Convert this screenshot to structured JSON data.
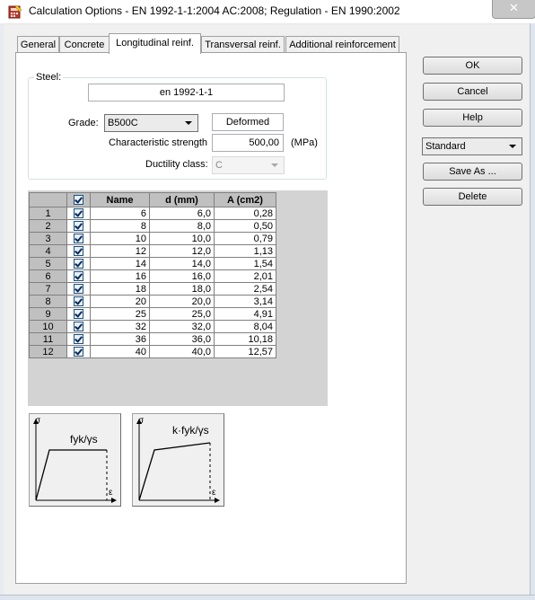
{
  "window": {
    "title": "Calculation Options - EN 1992-1-1:2004 AC:2008;   Regulation - EN 1990:2002",
    "close_glyph": "✕"
  },
  "tabs": [
    {
      "label": "General",
      "active": false
    },
    {
      "label": "Concrete",
      "active": false
    },
    {
      "label": "Longitudinal reinf.",
      "active": true
    },
    {
      "label": "Transversal reinf.",
      "active": false
    },
    {
      "label": "Additional reinforcement",
      "active": false
    }
  ],
  "steel": {
    "group_label": "Steel:",
    "standard_value": "en 1992-1-1",
    "grade_label": "Grade:",
    "grade_value": "B500C",
    "type_value": "Deformed",
    "char_strength_label": "Characteristic strength",
    "char_strength_value": "500,00",
    "char_strength_unit": "(MPa)",
    "ductility_label": "Ductility class:",
    "ductility_value": "C"
  },
  "bar_table": {
    "columns": [
      "Name",
      "d (mm)",
      "A (cm2)"
    ],
    "rows": [
      {
        "index": "1",
        "checked": true,
        "name": "6",
        "d": "6,0",
        "a": "0,28"
      },
      {
        "index": "2",
        "checked": true,
        "name": "8",
        "d": "8,0",
        "a": "0,50"
      },
      {
        "index": "3",
        "checked": true,
        "name": "10",
        "d": "10,0",
        "a": "0,79"
      },
      {
        "index": "4",
        "checked": true,
        "name": "12",
        "d": "12,0",
        "a": "1,13"
      },
      {
        "index": "5",
        "checked": true,
        "name": "14",
        "d": "14,0",
        "a": "1,54"
      },
      {
        "index": "6",
        "checked": true,
        "name": "16",
        "d": "16,0",
        "a": "2,01"
      },
      {
        "index": "7",
        "checked": true,
        "name": "18",
        "d": "18,0",
        "a": "2,54"
      },
      {
        "index": "8",
        "checked": true,
        "name": "20",
        "d": "20,0",
        "a": "3,14"
      },
      {
        "index": "9",
        "checked": true,
        "name": "25",
        "d": "25,0",
        "a": "4,91"
      },
      {
        "index": "10",
        "checked": true,
        "name": "32",
        "d": "32,0",
        "a": "8,04"
      },
      {
        "index": "11",
        "checked": true,
        "name": "36",
        "d": "36,0",
        "a": "10,18"
      },
      {
        "index": "12",
        "checked": true,
        "name": "40",
        "d": "40,0",
        "a": "12,57"
      }
    ]
  },
  "diagrams": {
    "y_axis_symbol": "σ",
    "x_axis_symbol": "ε",
    "left_label": "fyk/γs",
    "right_label": "k·fyk/γs"
  },
  "buttons": {
    "ok": "OK",
    "cancel": "Cancel",
    "help": "Help",
    "preset_value": "Standard",
    "save_as": "Save As ...",
    "delete": "Delete"
  }
}
